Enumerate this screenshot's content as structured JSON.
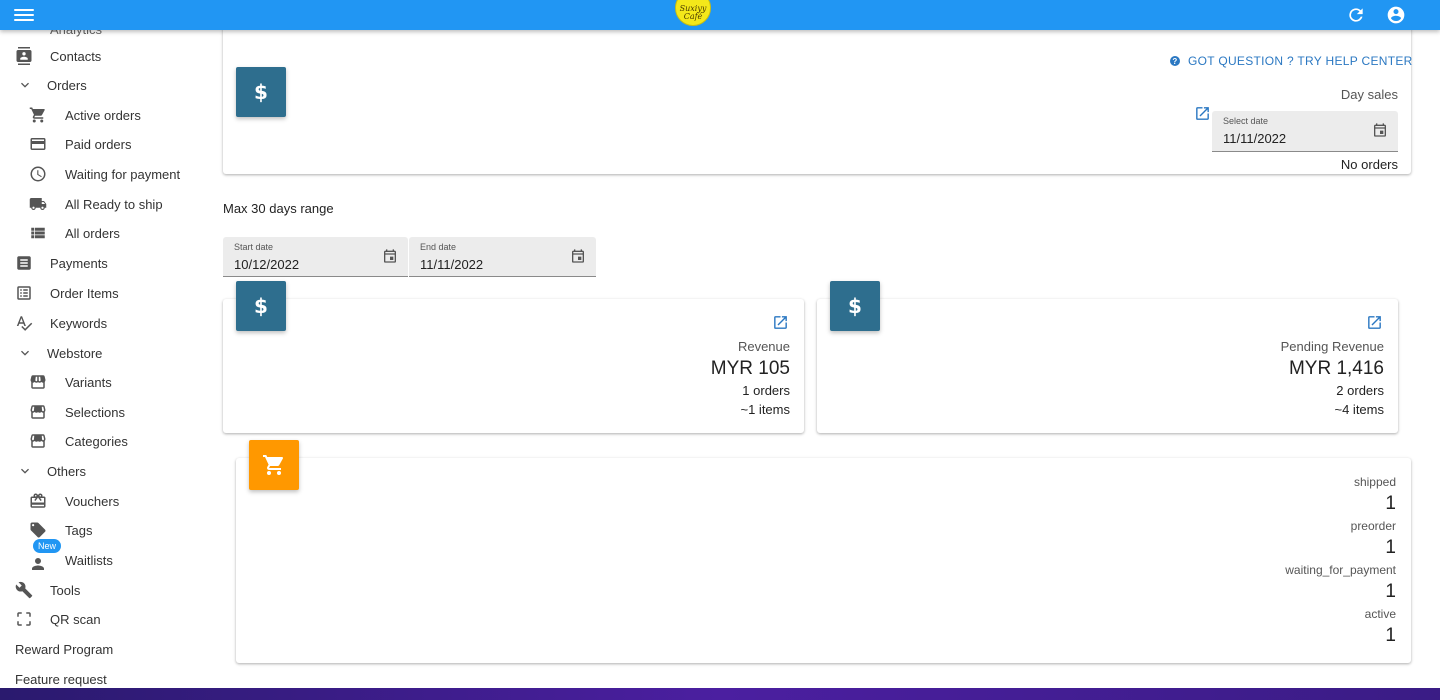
{
  "appbar": {
    "logo_line1": "Suxiyy",
    "logo_line2": "Café",
    "menu_icon": "menu-icon",
    "refresh_icon": "refresh-icon",
    "account_icon": "account-circle-icon",
    "color": "#2196f3"
  },
  "sidebar": {
    "partial_top": "Analytics",
    "items": [
      {
        "label": "Contacts",
        "icon": "contacts-icon"
      },
      {
        "label": "Orders",
        "icon": "chevron-down-icon"
      },
      {
        "label": "Active orders",
        "icon": "cart-icon"
      },
      {
        "label": "Paid orders",
        "icon": "credit-card-icon"
      },
      {
        "label": "Waiting for payment",
        "icon": "clock-icon"
      },
      {
        "label": "All Ready to ship",
        "icon": "truck-icon"
      },
      {
        "label": "All orders",
        "icon": "list-icon"
      },
      {
        "label": "Payments",
        "icon": "receipt-icon"
      },
      {
        "label": "Order Items",
        "icon": "checklist-icon"
      },
      {
        "label": "Keywords",
        "icon": "spellcheck-icon"
      },
      {
        "label": "Webstore",
        "icon": "chevron-down-icon"
      },
      {
        "label": "Variants",
        "icon": "store-icon"
      },
      {
        "label": "Selections",
        "icon": "store-icon"
      },
      {
        "label": "Categories",
        "icon": "store-icon"
      },
      {
        "label": "Others",
        "icon": "chevron-down-icon"
      },
      {
        "label": "Vouchers",
        "icon": "gift-card-icon"
      },
      {
        "label": "Tags",
        "icon": "tag-icon"
      },
      {
        "label": "Waitlists",
        "icon": "person-icon",
        "badge": "New"
      },
      {
        "label": "Tools",
        "icon": "wrench-icon"
      },
      {
        "label": "QR scan",
        "icon": "scan-icon"
      },
      {
        "label": "Reward Program"
      },
      {
        "label": "Feature request"
      }
    ]
  },
  "day_sales": {
    "help_link": "GOT QUESTION ? TRY HELP CENTER",
    "title": "Day sales",
    "date_label": "Select date",
    "date_value": "11/11/2022",
    "status": "No orders"
  },
  "range": {
    "note": "Max 30 days range",
    "start_label": "Start date",
    "start_value": "10/12/2022",
    "end_label": "End date",
    "end_value": "11/11/2022"
  },
  "revenue": {
    "badge_symbol": "$",
    "title": "Revenue",
    "amount": "MYR 105",
    "orders": "1 orders",
    "items": "~1 items"
  },
  "pending": {
    "badge_symbol": "$",
    "title": "Pending Revenue",
    "amount": "MYR 1,416",
    "orders": "2 orders",
    "items": "~4 items"
  },
  "day_badge_symbol": "$",
  "status_counts": [
    {
      "label": "shipped",
      "value": "1"
    },
    {
      "label": "preorder",
      "value": "1"
    },
    {
      "label": "waiting_for_payment",
      "value": "1"
    },
    {
      "label": "active",
      "value": "1"
    }
  ],
  "colors": {
    "teal": "#2e6e8e",
    "orange": "#ff9800",
    "link": "#2b78c2"
  }
}
